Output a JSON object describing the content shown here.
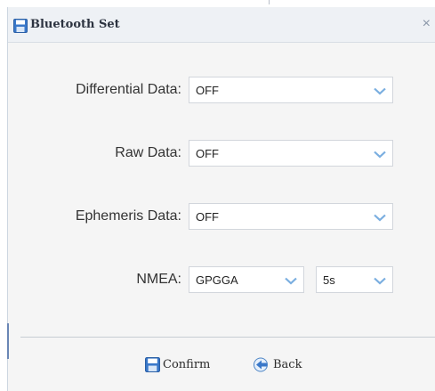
{
  "window": {
    "title": "Bluetooth Set",
    "close_label": "×"
  },
  "fields": {
    "differential": {
      "label": "Differential Data:",
      "value": "OFF"
    },
    "raw": {
      "label": "Raw Data:",
      "value": "OFF"
    },
    "ephemeris": {
      "label": "Ephemeris Data:",
      "value": "OFF"
    },
    "nmea": {
      "label": "NMEA:",
      "sentence": "GPGGA",
      "interval": "5s"
    }
  },
  "footer": {
    "confirm_label": "Confirm",
    "back_label": "Back"
  },
  "colors": {
    "accent_blue": "#3a78c9",
    "chevron": "#7aaee0",
    "dialog_bg": "#f5f5f5"
  },
  "icons": {
    "title": "save-disk-icon",
    "close": "close-icon",
    "select": "chevron-down-icon",
    "confirm": "save-disk-icon",
    "back": "back-arrow-icon"
  }
}
